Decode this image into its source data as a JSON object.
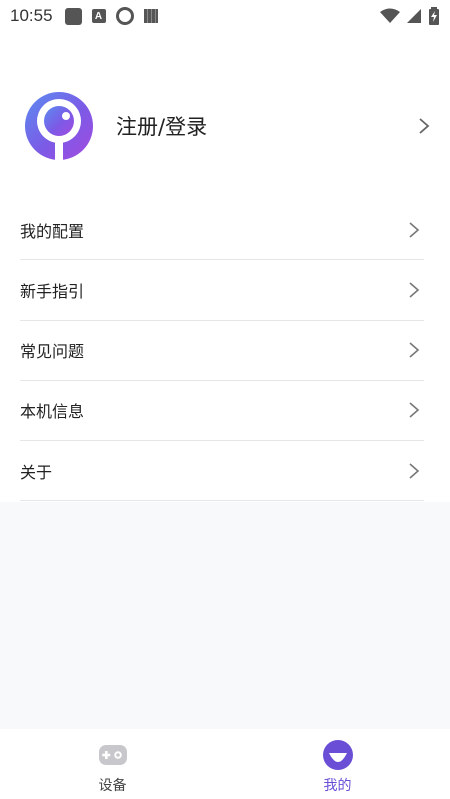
{
  "status_bar": {
    "time": "10:55",
    "icons": [
      "notification-square-icon",
      "app-a-icon",
      "chrome-like-icon",
      "book-icon",
      "wifi-icon",
      "signal-icon",
      "battery-charging-icon"
    ]
  },
  "profile": {
    "label": "注册/登录",
    "avatar_icon": "logo-avatar-icon"
  },
  "menu": {
    "items": [
      {
        "label": "我的配置"
      },
      {
        "label": "新手指引"
      },
      {
        "label": "常见问题"
      },
      {
        "label": "本机信息"
      },
      {
        "label": "关于"
      }
    ]
  },
  "bottom_nav": {
    "tabs": [
      {
        "label": "设备",
        "icon": "gamepad-icon",
        "active": false
      },
      {
        "label": "我的",
        "icon": "profile-face-icon",
        "active": true
      }
    ]
  },
  "colors": {
    "accent": "#6a4fd6",
    "background": "#f8f9fb",
    "divider": "#e6e6e6",
    "inactive_icon": "#c7c7cc"
  }
}
